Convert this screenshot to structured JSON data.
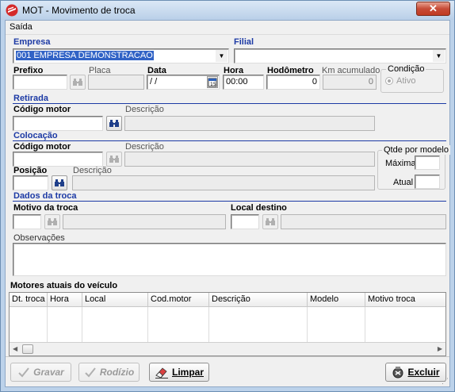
{
  "window": {
    "title": "MOT - Movimento de troca",
    "close_glyph": "✕"
  },
  "menu": {
    "items": [
      "Saída"
    ]
  },
  "empresa": {
    "label": "Empresa",
    "value": "001 EMPRESA DEMONSTRACAO"
  },
  "filial": {
    "label": "Filial",
    "value": ""
  },
  "row1": {
    "prefixo_label": "Prefixo",
    "prefixo_value": "",
    "placa_label": "Placa",
    "placa_value": "",
    "data_label": "Data",
    "data_value": " / /",
    "hora_label": "Hora",
    "hora_value": "00:00",
    "hodometro_label": "Hodômetro",
    "hodometro_value": "0",
    "km_label": "Km acumulado",
    "km_value": "0"
  },
  "condicao": {
    "title": "Condição",
    "option": "Ativo"
  },
  "retirada": {
    "section": "Retirada",
    "codigo_label": "Código motor",
    "codigo_value": "",
    "descricao_label": "Descrição",
    "descricao_value": ""
  },
  "colocacao": {
    "section": "Colocação",
    "codigo_label": "Código motor",
    "codigo_value": "",
    "descricao_label": "Descrição",
    "descricao_value": "",
    "posicao_label": "Posição",
    "posicao_value": "",
    "posdesc_label": "Descrição",
    "posdesc_value": ""
  },
  "qtde": {
    "title": "Qtde por modelo",
    "maxima_label": "Máxima",
    "maxima_value": "",
    "atual_label": "Atual",
    "atual_value": ""
  },
  "dados": {
    "section": "Dados da troca",
    "motivo_label": "Motivo da troca",
    "motivo_value": "",
    "local_label": "Local destino",
    "local_value": "",
    "obs_label": "Observações",
    "obs_value": ""
  },
  "motores": {
    "title": "Motores atuais do veículo",
    "columns": [
      "Dt. troca",
      "Hora",
      "Local",
      "Cod.motor",
      "Descrição",
      "Modelo",
      "Motivo troca"
    ]
  },
  "buttons": {
    "gravar_label": "Gravar",
    "rodizio_label": "Rodízio",
    "limpar_label": "Limpar",
    "excluir_label": "Excluir"
  },
  "icons": {
    "app": "app-logo-icon",
    "search": "binoculars-icon",
    "calendar": "calendar-icon",
    "gravar": "check-icon",
    "rodizio": "check-icon",
    "limpar": "eraser-icon",
    "excluir": "delete-icon"
  },
  "colors": {
    "section_blue": "#1c3aa5",
    "selection": "#3163c6",
    "close_red": "#c74c37",
    "title_bg": "#bcd2ea"
  }
}
